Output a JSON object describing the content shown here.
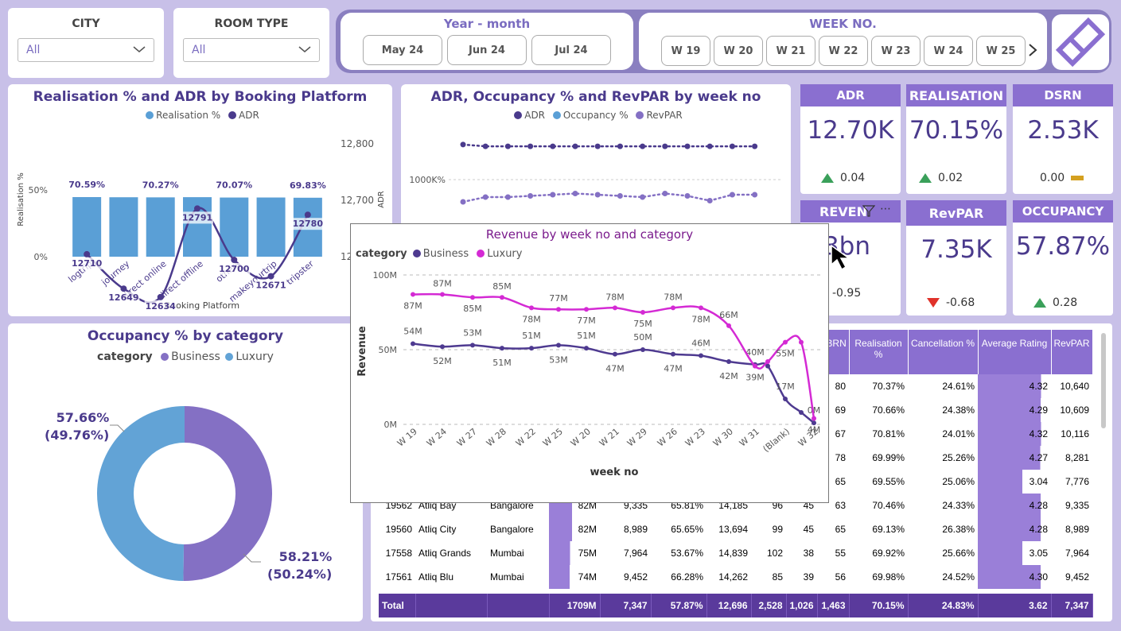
{
  "slicers": {
    "city": {
      "title": "CITY",
      "value": "All"
    },
    "room_type": {
      "title": "ROOM TYPE",
      "value": "All"
    }
  },
  "year_month": {
    "title": "Year - month",
    "items": [
      "May 24",
      "Jun 24",
      "Jul 24"
    ]
  },
  "week_no": {
    "title": "WEEK NO.",
    "items": [
      "W 19",
      "W 20",
      "W 21",
      "W 22",
      "W 23",
      "W 24",
      "W 25"
    ]
  },
  "kpis": {
    "adr": {
      "label": "ADR",
      "value": "12.70K",
      "delta": "0.04",
      "dir": "up"
    },
    "realisation": {
      "label": "REALISATION",
      "value": "70.15%",
      "delta": "0.02",
      "dir": "up"
    },
    "dsrn": {
      "label": "DSRN",
      "value": "2.53K",
      "delta": "0.00",
      "dir": "flat"
    },
    "revenue": {
      "label": "REVEN",
      "value": "3bn",
      "delta": "-0.95",
      "dir": "down"
    },
    "revpar": {
      "label": "RevPAR",
      "value": "7.35K",
      "delta": "-0.68",
      "dir": "down"
    },
    "occupancy": {
      "label": "OCCUPANCY",
      "value": "57.87%",
      "delta": "0.28",
      "dir": "up"
    }
  },
  "chart_realisation": {
    "title": "Realisation % and ADR by Booking Platform",
    "legend": [
      "Realisation %",
      "ADR"
    ],
    "xlabel": "Booking Platform",
    "ylabel_left": "Realisation %",
    "ylabel_right": "ADR",
    "yticks_left": [
      "50%",
      "0%"
    ],
    "yticks_right": [
      "12,800",
      "12,700",
      "12"
    ],
    "colors": {
      "bar": "#5a9fd6",
      "line": "#4a3a8c"
    }
  },
  "chart_weekly": {
    "title": "ADR, Occupancy % and RevPAR by week no",
    "legend": [
      "ADR",
      "Occupancy %",
      "RevPAR"
    ],
    "ytick": "1000K%"
  },
  "chart_occupancy": {
    "title": "Occupancy % by category",
    "legend_title": "category",
    "legend": [
      "Business",
      "Luxury"
    ],
    "label_luxury": [
      "57.66%",
      "(49.76%)"
    ],
    "label_business": [
      "58.21%",
      "(50.24%)"
    ],
    "colors": {
      "business": "#8470c4",
      "luxury": "#62a3d6"
    }
  },
  "chart_revenue": {
    "title": "Revenue by week no and category",
    "legend_title": "category",
    "legend": [
      "Business",
      "Luxury"
    ],
    "xlabel": "week no",
    "ylabel": "Revenue",
    "yticks": [
      "100M",
      "50M",
      "0M"
    ],
    "colors": {
      "business": "#4e3a90",
      "luxury": "#d42ad4"
    }
  },
  "chart_data": [
    {
      "type": "bar",
      "title": "Realisation % and ADR by Booking Platform",
      "xlabel": "Booking Platform",
      "categories": [
        "logtrip",
        "journey",
        "direct online",
        "direct offline",
        "others",
        "makeyourtrip",
        "tripster"
      ],
      "series": [
        {
          "name": "Realisation %",
          "values": [
            70.59,
            70.4,
            70.27,
            70.5,
            70.07,
            70.1,
            69.83
          ],
          "labels": [
            "70.59%",
            "",
            "70.27%",
            "",
            "70.07%",
            "",
            "69.83%"
          ]
        },
        {
          "name": "ADR",
          "type": "line",
          "values": [
            12710,
            12649,
            12634,
            12791,
            12700,
            12671,
            12780
          ],
          "labels": [
            "12710",
            "12649",
            "12634",
            "12791",
            "12700",
            "12671",
            "12780"
          ]
        }
      ]
    },
    {
      "type": "line",
      "title": "ADR, Occupancy % and RevPAR by week no",
      "x": [
        "1",
        "2",
        "3",
        "4",
        "5",
        "6",
        "7",
        "8",
        "9",
        "10",
        "11",
        "12",
        "13",
        "14"
      ],
      "series": [
        {
          "name": "ADR",
          "values": [
            1.11,
            1.09,
            1.09,
            1.09,
            1.09,
            1.09,
            1.09,
            1.09,
            1.09,
            1.09,
            1.09,
            1.09,
            1.09,
            1.09
          ]
        },
        {
          "name": "Occupancy %",
          "values": [
            0.78,
            0.82,
            0.82,
            0.83,
            0.84,
            0.85,
            0.84,
            0.83,
            0.82,
            0.85,
            0.83,
            0.79,
            0.84,
            0.84
          ]
        },
        {
          "name": "RevPAR",
          "values": [
            0.5,
            0.55,
            0.55,
            0.55,
            0.55,
            0.55,
            0.55,
            0.55,
            0.55,
            0.55,
            0.55,
            0.55,
            0.55,
            0.55
          ]
        }
      ]
    },
    {
      "type": "pie",
      "title": "Occupancy % by category",
      "categories": [
        "Business",
        "Luxury"
      ],
      "values": [
        58.21,
        57.66
      ],
      "shares": [
        50.24,
        49.76
      ]
    },
    {
      "type": "line",
      "title": "Revenue by week no and category",
      "xlabel": "week no",
      "ylabel": "Revenue",
      "categories": [
        "W 19",
        "W 24",
        "W 27",
        "W 28",
        "W 22",
        "W 25",
        "W 20",
        "W 21",
        "W 29",
        "W 26",
        "W 23",
        "W 30",
        "W 31",
        "(Blank)",
        "W 32"
      ],
      "x_points": [
        "W 19",
        "W 24",
        "W 27",
        "W 28",
        "W 22",
        "W 25",
        "W 20",
        "W 21",
        "W 29",
        "W 26",
        "W 23",
        "W 30",
        "W 31",
        "",
        "(Blank)",
        "",
        "W 32"
      ],
      "ylim": [
        0,
        100
      ],
      "series": [
        {
          "name": "Business",
          "values": [
            54,
            52,
            53,
            51,
            51,
            53,
            51,
            47,
            50,
            47,
            46,
            42,
            40,
            39,
            17,
            8,
            1
          ],
          "labels": [
            "54M",
            "52M",
            "53M",
            "51M",
            "51M",
            "53M",
            "51M",
            "47M",
            "50M",
            "47M",
            "46M",
            "42M",
            "40M",
            "",
            "17M",
            "",
            "0M"
          ]
        },
        {
          "name": "Luxury",
          "values": [
            87,
            87,
            85,
            85,
            78,
            77,
            77,
            78,
            75,
            78,
            78,
            66,
            39,
            42,
            55,
            55,
            4
          ],
          "labels": [
            "87M",
            "87M",
            "85M",
            "85M",
            "78M",
            "77M",
            "77M",
            "78M",
            "75M",
            "78M",
            "78M",
            "66M",
            "39M",
            "",
            "55M",
            "",
            "4M"
          ]
        }
      ]
    }
  ],
  "table": {
    "headers": [
      "DBRN",
      "Realisation %",
      "Cancellation %",
      "Average Rating",
      "RevPAR"
    ],
    "rows_partial": [
      [
        "80",
        "70.37%",
        "24.61%",
        "4.32",
        "10,640"
      ],
      [
        "69",
        "70.66%",
        "24.38%",
        "4.29",
        "10,609"
      ],
      [
        "67",
        "70.81%",
        "24.01%",
        "4.32",
        "10,116"
      ],
      [
        "78",
        "69.99%",
        "25.26%",
        "4.27",
        "8,281"
      ],
      [
        "65",
        "69.55%",
        "25.06%",
        "3.04",
        "7,776"
      ]
    ],
    "rows_full": [
      [
        "19562",
        "Atliq Bay",
        "Bangalore",
        "82M",
        "9,335",
        "65.81%",
        "14,185",
        "96",
        "45",
        "63",
        "70.46%",
        "24.33%",
        "4.28",
        "9,335"
      ],
      [
        "19560",
        "Atliq City",
        "Bangalore",
        "82M",
        "8,989",
        "65.65%",
        "13,694",
        "99",
        "45",
        "65",
        "69.13%",
        "26.38%",
        "4.28",
        "8,989"
      ],
      [
        "17558",
        "Atliq Grands",
        "Mumbai",
        "75M",
        "7,964",
        "53.67%",
        "14,839",
        "102",
        "38",
        "55",
        "69.92%",
        "25.66%",
        "3.05",
        "7,964"
      ],
      [
        "17561",
        "Atliq Blu",
        "Mumbai",
        "74M",
        "9,452",
        "66.28%",
        "14,262",
        "85",
        "39",
        "56",
        "69.98%",
        "24.52%",
        "4.30",
        "9,452"
      ]
    ],
    "total": [
      "Total",
      "",
      "",
      "1709M",
      "7,347",
      "57.87%",
      "12,696",
      "2,528",
      "1,026",
      "1,463",
      "70.15%",
      "24.83%",
      "3.62",
      "7,347"
    ],
    "colors": {
      "bar": "#9a7fd8",
      "header": "#8a6fd0",
      "total": "#5a3a9c"
    }
  }
}
